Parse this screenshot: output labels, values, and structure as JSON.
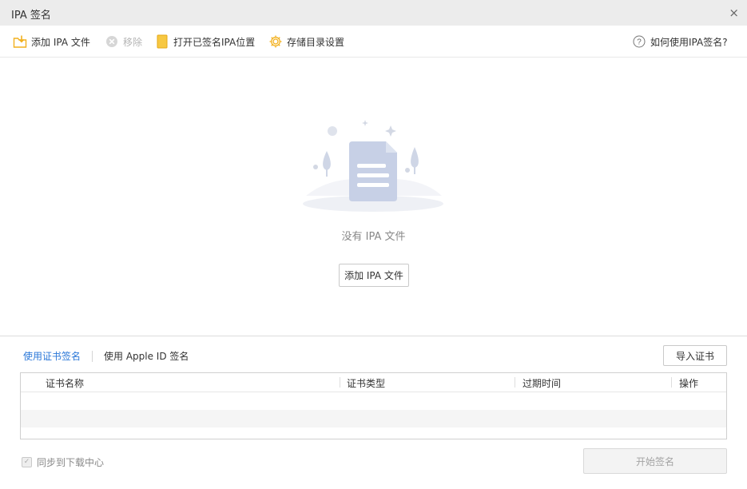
{
  "window": {
    "title": "IPA 签名",
    "close_glyph": "×"
  },
  "toolbar": {
    "add": {
      "label": "添加 IPA 文件",
      "icon": "folder-add-icon"
    },
    "remove": {
      "label": "移除",
      "icon": "remove-circle-icon"
    },
    "open_signed": {
      "label": "打开已签名IPA位置",
      "icon": "folder-icon"
    },
    "storage": {
      "label": "存储目录设置",
      "icon": "gear-icon"
    },
    "help": {
      "label": "如何使用IPA签名?",
      "icon": "question-circle-icon"
    }
  },
  "empty_state": {
    "message": "没有 IPA 文件",
    "button_label": "添加 IPA 文件"
  },
  "sign_tabs": [
    {
      "label": "使用证书签名",
      "active": true
    },
    {
      "label": "使用 Apple ID 签名",
      "active": false
    }
  ],
  "import_cert_label": "导入证书",
  "cert_table": {
    "columns": [
      "证书名称",
      "证书类型",
      "过期时间",
      "操作"
    ],
    "rows": []
  },
  "sync": {
    "label": "同步到下载中心",
    "checked": true,
    "disabled": true
  },
  "start_button_label": "开始签名",
  "colors": {
    "accent": "#2a77d8",
    "icon_yellow": "#f2b01e",
    "illustration": "#c7d0e6"
  }
}
